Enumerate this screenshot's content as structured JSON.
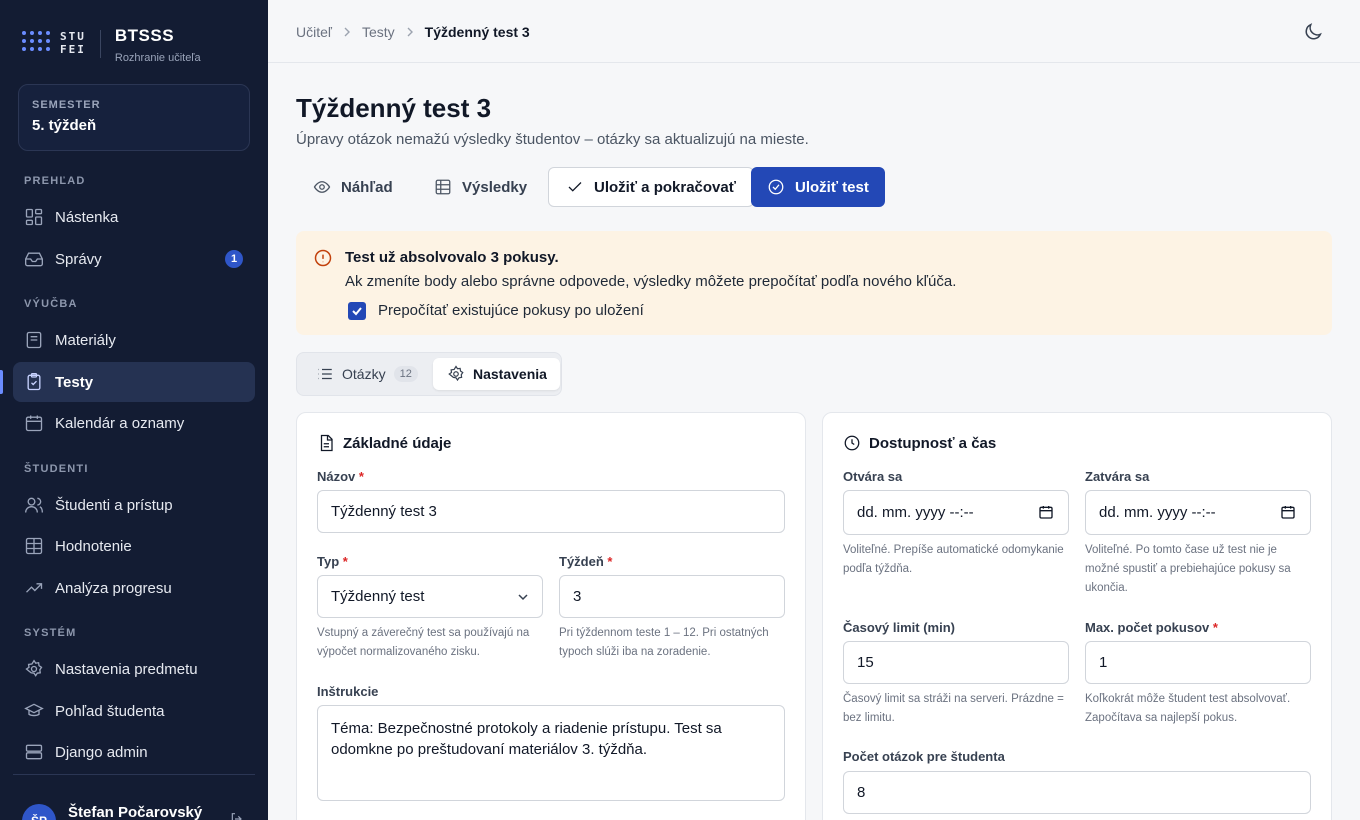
{
  "brand": {
    "logo_text": "STU FEI",
    "name": "BTSSS",
    "subtitle": "Rozhranie učiteľa"
  },
  "semester": {
    "label": "SEMESTER",
    "value": "5. týždeň"
  },
  "sidebar": {
    "sections": [
      "PREHĽAD",
      "VÝUČBA",
      "ŠTUDENTI",
      "SYSTÉM"
    ],
    "items": [
      {
        "label": "Nástenka",
        "icon": "dashboard-icon"
      },
      {
        "label": "Správy",
        "icon": "inbox-icon",
        "badge": "1"
      },
      {
        "label": "Materiály",
        "icon": "book-icon"
      },
      {
        "label": "Testy",
        "icon": "clipboard-check-icon",
        "active": true
      },
      {
        "label": "Kalendár a oznamy",
        "icon": "calendar-icon"
      },
      {
        "label": "Študenti a prístup",
        "icon": "users-icon"
      },
      {
        "label": "Hodnotenie",
        "icon": "table-icon"
      },
      {
        "label": "Analýza progresu",
        "icon": "trending-icon"
      },
      {
        "label": "Nastavenia predmetu",
        "icon": "gear-icon"
      },
      {
        "label": "Pohľad študenta",
        "icon": "graduation-cap-icon"
      },
      {
        "label": "Django admin",
        "icon": "server-icon"
      }
    ]
  },
  "user": {
    "name": "Štefan Počarovský",
    "initials": "ŠP"
  },
  "breadcrumb": {
    "items": [
      "Učiteľ",
      "Testy"
    ],
    "current": "Týždenný test 3"
  },
  "page": {
    "title": "Týždenný test 3",
    "subtitle": "Úpravy otázok nemažú výsledky študentov – otázky sa aktualizujú na mieste."
  },
  "actions": {
    "preview": "Náhľad",
    "results": "Výsledky",
    "save_continue": "Uložiť a pokračovať",
    "save": "Uložiť test"
  },
  "alert": {
    "title": "Test už absolvovalo 3 pokusy.",
    "description": "Ak zmeníte body alebo správne odpovede, výsledky môžete prepočítať podľa nového kľúča.",
    "checkbox_label": "Prepočítať existujúce pokusy po uložení",
    "checked": true
  },
  "tabs": {
    "questions": "Otázky",
    "questions_count": "12",
    "settings": "Nastavenia",
    "active": "settings"
  },
  "basic": {
    "heading": "Základné údaje",
    "name_label": "Názov",
    "name_value": "Týždenný test 3",
    "type_label": "Typ",
    "type_value": "Týždenný test",
    "type_help": "Vstupný a záverečný test sa používajú na výpočet normalizovaného zisku.",
    "week_label": "Týždeň",
    "week_value": "3",
    "week_help": "Pri týždennom teste 1 – 12. Pri ostatných typoch slúži iba na zoradenie.",
    "instructions_label": "Inštrukcie",
    "instructions_value": "Téma: Bezpečnostné protokoly a riadenie prístupu. Test sa odomkne po preštudovaní materiálov 3. týždňa."
  },
  "availability": {
    "heading": "Dostupnosť a čas",
    "opens_label": "Otvára sa",
    "opens_placeholder": "dd. mm. yyyy --:--",
    "opens_help": "Voliteľné. Prepíše automatické odomykanie podľa týždňa.",
    "closes_label": "Zatvára sa",
    "closes_placeholder": "dd. mm. yyyy --:--",
    "closes_help": "Voliteľné. Po tomto čase už test nie je možné spustiť a prebiehajúce pokusy sa ukončia.",
    "time_limit_label": "Časový limit (min)",
    "time_limit_value": "15",
    "time_limit_help": "Časový limit sa stráži na serveri. Prázdne = bez limitu.",
    "max_attempts_label": "Max. počet pokusov",
    "max_attempts_value": "1",
    "max_attempts_help": "Koľkokrát môže študent test absolvovať. Započítava sa najlepší pokus.",
    "questions_per_student_label": "Počet otázok pre študenta",
    "questions_per_student_value": "8"
  },
  "colors": {
    "sidebar_bg": "#131c33",
    "primary": "#2348b6",
    "alert_bg": "#fdf3e4",
    "alert_icon": "#c2410c",
    "required": "#dc2626"
  }
}
